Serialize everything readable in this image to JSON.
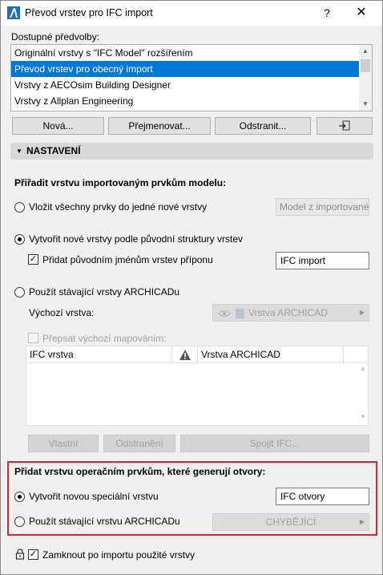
{
  "window": {
    "title": "Převod vrstev pro IFC import",
    "help_label": "?",
    "close_label": "✕"
  },
  "presets": {
    "label": "Dostupné předvolby:",
    "items": [
      "Originální vrstvy s \"IFC Model\" rozšířením",
      "Převod vrstev pro obecný import",
      "Vrstvy z AECOsim Building Designer",
      "Vrstvy z Allplan Engineering"
    ],
    "selected": "Převod vrstev pro obecný import",
    "buttons": {
      "new": "Nová...",
      "rename": "Přejmenovat...",
      "delete": "Odstranit..."
    }
  },
  "settings": {
    "section_title": "NASTAVENÍ",
    "assign_heading": "Přiřadit vrstvu importovaným prvkům modelu:",
    "opt_single": {
      "label": "Vložit všechny prvky do jedné nové vrstvy",
      "button": "Model z importované"
    },
    "opt_structure": {
      "label": "Vytvořit nové vrstvy podle původní struktury vrstev",
      "suffix_label": "Přidat původním jménům vrstev příponu",
      "suffix_checked": true,
      "suffix_value": "IFC import"
    },
    "opt_existing": {
      "label": "Použít stávající vrstvy ARCHICADu",
      "default_layer_label": "Výchozí vrstva:",
      "default_layer_value": "Vrstva ARCHICAD",
      "override_label": "Přepsat výchozí mapováním:",
      "table": {
        "col_ifc": "IFC vrstva",
        "col_archicad": "Vrstva ARCHICAD"
      },
      "buttons": {
        "custom": "Vlastní",
        "remove": "Odstranění",
        "merge": "Spojit IFC..."
      }
    },
    "selected_option": "structure"
  },
  "openings": {
    "heading": "Přidat vrstvu operačním prvkům, které generují otvory:",
    "opt_new": {
      "label": "Vytvořit novou speciální vrstvu",
      "value": "IFC otvory"
    },
    "opt_existing": {
      "label": "Použít stávající vrstvu ARCHICADu",
      "value": "CHYBĚJÍCÍ"
    },
    "selected_option": "new"
  },
  "lock": {
    "label": "Zamknout po importu použité vrstvy",
    "checked": true
  },
  "colors": {
    "selection": "#0078d7",
    "highlight_border": "#e0242c"
  }
}
